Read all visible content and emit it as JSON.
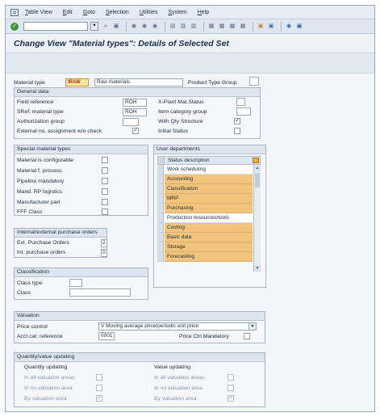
{
  "menu": [
    "Table View",
    "Edit",
    "Goto",
    "Selection",
    "Utilities",
    "System",
    "Help"
  ],
  "title": "Change View \"Material types\": Details of Selected Set",
  "header": {
    "material_type_label": "Material type",
    "material_type_value": "IRAW",
    "material_type_desc": "Raw materials",
    "product_type_group_label": "Product Type Group"
  },
  "general": {
    "title": "General data",
    "field_reference_label": "Field reference",
    "field_reference_value": "ROH",
    "sref_label": "SRef: material type",
    "sref_value": "ROH",
    "auth_group_label": "Authorization group",
    "ext_no_label": "External no. assignment w/o check",
    "xplant_label": "X-Plant Mat.Status",
    "item_cat_label": "Item category group",
    "qty_structure_label": "With Qty Structure",
    "qty_structure_checked": "✓",
    "initial_status_label": "Initial Status",
    "ext_no_checked": "✓"
  },
  "special": {
    "title": "Special material types",
    "items": [
      "Material is configurable",
      "Material f. process",
      "Pipeline mandatory",
      "Mand. RP logistics",
      "Manufacturer part",
      "FFF Class"
    ]
  },
  "user_departments": {
    "title": "User departments",
    "column": "Status description",
    "rows": [
      {
        "label": "Work scheduling",
        "selected": false
      },
      {
        "label": "Accounting",
        "selected": true
      },
      {
        "label": "Classification",
        "selected": true
      },
      {
        "label": "MRP",
        "selected": true
      },
      {
        "label": "Purchasing",
        "selected": true
      },
      {
        "label": "Production resources/tools",
        "selected": false
      },
      {
        "label": "Costing",
        "selected": true
      },
      {
        "label": "Basic data",
        "selected": true
      },
      {
        "label": "Storage",
        "selected": true
      },
      {
        "label": "Forecasting",
        "selected": true
      }
    ]
  },
  "purchase_orders": {
    "title": "Internal/external purchase orders",
    "ext_label": "Ext. Purchase Orders",
    "ext_value": "2",
    "int_label": "Int. purchase orders",
    "int_value": "0"
  },
  "classification": {
    "title": "Classification",
    "class_type_label": "Class type",
    "class_label": "Class"
  },
  "valuation": {
    "title": "Valuation",
    "price_control_label": "Price control",
    "price_control_value": "V Moving average price/periodic unit price",
    "acct_cat_label": "Acct cat. reference",
    "acct_cat_value": "0001",
    "price_ctrl_mandatory_label": "Price Ctrl.Mandatory"
  },
  "qty_value": {
    "title": "Quantity/value updating",
    "qty_heading": "Quantity updating",
    "value_heading": "Value updating",
    "rows": [
      "In all valuation areas",
      "In no valuation area",
      "By valuation area"
    ],
    "by_area_checked": "✓"
  }
}
